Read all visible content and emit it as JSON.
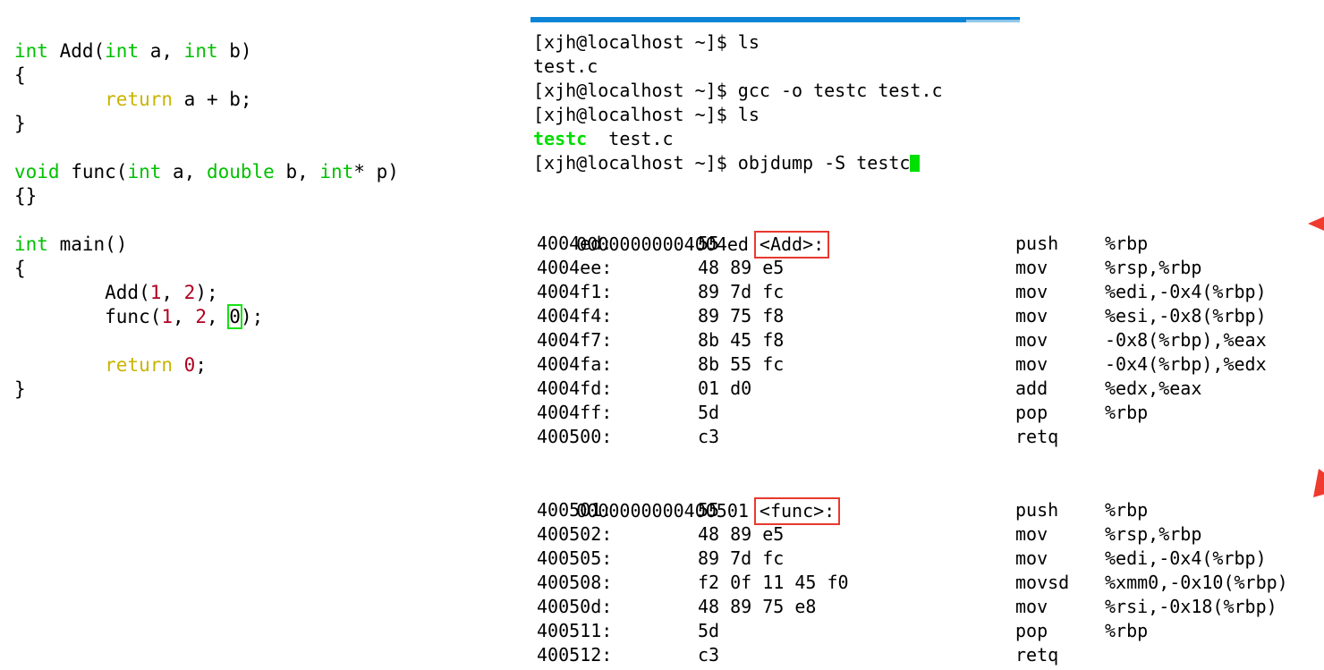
{
  "source_code": {
    "lines": [
      [
        {
          "t": "int",
          "c": "kw"
        },
        {
          "t": " Add(",
          "c": "plain"
        },
        {
          "t": "int",
          "c": "kw"
        },
        {
          "t": " a, ",
          "c": "plain"
        },
        {
          "t": "int",
          "c": "kw"
        },
        {
          "t": " b)",
          "c": "plain"
        }
      ],
      [
        {
          "t": "{",
          "c": "plain"
        }
      ],
      [
        {
          "t": "        ",
          "c": "plain"
        },
        {
          "t": "return",
          "c": "ret"
        },
        {
          "t": " a + b;",
          "c": "plain"
        }
      ],
      [
        {
          "t": "}",
          "c": "plain"
        }
      ],
      [
        {
          "t": "",
          "c": "plain"
        }
      ],
      [
        {
          "t": "void",
          "c": "kw"
        },
        {
          "t": " func(",
          "c": "plain"
        },
        {
          "t": "int",
          "c": "kw"
        },
        {
          "t": " a, ",
          "c": "plain"
        },
        {
          "t": "double",
          "c": "kw"
        },
        {
          "t": " b, ",
          "c": "plain"
        },
        {
          "t": "int",
          "c": "kw"
        },
        {
          "t": "* p)",
          "c": "plain"
        }
      ],
      [
        {
          "t": "{}",
          "c": "plain"
        }
      ],
      [
        {
          "t": "",
          "c": "plain"
        }
      ],
      [
        {
          "t": "int",
          "c": "kw"
        },
        {
          "t": " main()",
          "c": "plain"
        }
      ],
      [
        {
          "t": "{",
          "c": "plain"
        }
      ],
      [
        {
          "t": "        Add(",
          "c": "plain"
        },
        {
          "t": "1",
          "c": "num"
        },
        {
          "t": ", ",
          "c": "plain"
        },
        {
          "t": "2",
          "c": "num"
        },
        {
          "t": ");",
          "c": "plain"
        }
      ],
      [
        {
          "t": "        func(",
          "c": "plain"
        },
        {
          "t": "1",
          "c": "num"
        },
        {
          "t": ", ",
          "c": "plain"
        },
        {
          "t": "2",
          "c": "num"
        },
        {
          "t": ", ",
          "c": "plain"
        },
        {
          "t": "0",
          "c": "selbox"
        },
        {
          "t": ");",
          "c": "plain"
        }
      ],
      [
        {
          "t": "",
          "c": "plain"
        }
      ],
      [
        {
          "t": "        ",
          "c": "plain"
        },
        {
          "t": "return",
          "c": "ret"
        },
        {
          "t": " ",
          "c": "plain"
        },
        {
          "t": "0",
          "c": "num"
        },
        {
          "t": ";",
          "c": "plain"
        }
      ],
      [
        {
          "t": "}",
          "c": "plain"
        }
      ]
    ]
  },
  "terminal": {
    "prompt": "[xjh@localhost ~]$ ",
    "lines": [
      [
        {
          "t": "[xjh@localhost ~]$ ls",
          "c": "plain"
        }
      ],
      [
        {
          "t": "test.c",
          "c": "plain"
        }
      ],
      [
        {
          "t": "[xjh@localhost ~]$ gcc -o testc test.c",
          "c": "plain"
        }
      ],
      [
        {
          "t": "[xjh@localhost ~]$ ls",
          "c": "plain"
        }
      ],
      [
        {
          "t": "testc",
          "c": "t-green"
        },
        {
          "t": "  test.c",
          "c": "plain"
        }
      ],
      [
        {
          "t": "[xjh@localhost ~]$ objdump -S testc",
          "c": "plain"
        },
        {
          "t": "",
          "c": "cursor"
        }
      ]
    ],
    "commands": [
      "ls",
      "gcc -o testc test.c",
      "ls",
      "objdump -S testc"
    ],
    "files": [
      "test.c",
      "testc"
    ]
  },
  "disassembly": {
    "blocks": [
      {
        "address": "00000000004004ed",
        "symbol": "<Add>:",
        "instructions": [
          {
            "addr": "4004ed:",
            "bytes": "55",
            "mnemonic": "push",
            "operands": "%rbp"
          },
          {
            "addr": "4004ee:",
            "bytes": "48 89 e5",
            "mnemonic": "mov",
            "operands": "%rsp,%rbp"
          },
          {
            "addr": "4004f1:",
            "bytes": "89 7d fc",
            "mnemonic": "mov",
            "operands": "%edi,-0x4(%rbp)"
          },
          {
            "addr": "4004f4:",
            "bytes": "89 75 f8",
            "mnemonic": "mov",
            "operands": "%esi,-0x8(%rbp)"
          },
          {
            "addr": "4004f7:",
            "bytes": "8b 45 f8",
            "mnemonic": "mov",
            "operands": "-0x8(%rbp),%eax"
          },
          {
            "addr": "4004fa:",
            "bytes": "8b 55 fc",
            "mnemonic": "mov",
            "operands": "-0x4(%rbp),%edx"
          },
          {
            "addr": "4004fd:",
            "bytes": "01 d0",
            "mnemonic": "add",
            "operands": "%edx,%eax"
          },
          {
            "addr": "4004ff:",
            "bytes": "5d",
            "mnemonic": "pop",
            "operands": "%rbp"
          },
          {
            "addr": "400500:",
            "bytes": "c3",
            "mnemonic": "retq",
            "operands": ""
          }
        ]
      },
      {
        "address": "0000000000400501",
        "symbol": "<func>:",
        "instructions": [
          {
            "addr": "400501:",
            "bytes": "55",
            "mnemonic": "push",
            "operands": "%rbp"
          },
          {
            "addr": "400502:",
            "bytes": "48 89 e5",
            "mnemonic": "mov",
            "operands": "%rsp,%rbp"
          },
          {
            "addr": "400505:",
            "bytes": "89 7d fc",
            "mnemonic": "mov",
            "operands": "%edi,-0x4(%rbp)"
          },
          {
            "addr": "400508:",
            "bytes": "f2 0f 11 45 f0",
            "mnemonic": "movsd",
            "operands": "%xmm0,-0x10(%rbp)"
          },
          {
            "addr": "40050d:",
            "bytes": "48 89 75 e8",
            "mnemonic": "mov",
            "operands": "%rsi,-0x18(%rbp)"
          },
          {
            "addr": "400511:",
            "bytes": "5d",
            "mnemonic": "pop",
            "operands": "%rbp"
          },
          {
            "addr": "400512:",
            "bytes": "c3",
            "mnemonic": "retq",
            "operands": ""
          }
        ]
      }
    ]
  },
  "annotations": {
    "arrow_color": "#ef3a2e",
    "highlight_box_color": "#e8392e",
    "selection_box_color": "#13e313",
    "arrows": [
      {
        "name": "arrow-pointing-to-add-symbol",
        "direction": "left"
      },
      {
        "name": "arrow-pointing-to-func-symbol",
        "direction": "down-left"
      }
    ]
  },
  "colors": {
    "keyword_green": "#00c100",
    "return_yellow": "#c8b400",
    "number_red": "#b00020",
    "terminal_green": "#00dd00",
    "titlebar_blue": "#0b84d6"
  }
}
